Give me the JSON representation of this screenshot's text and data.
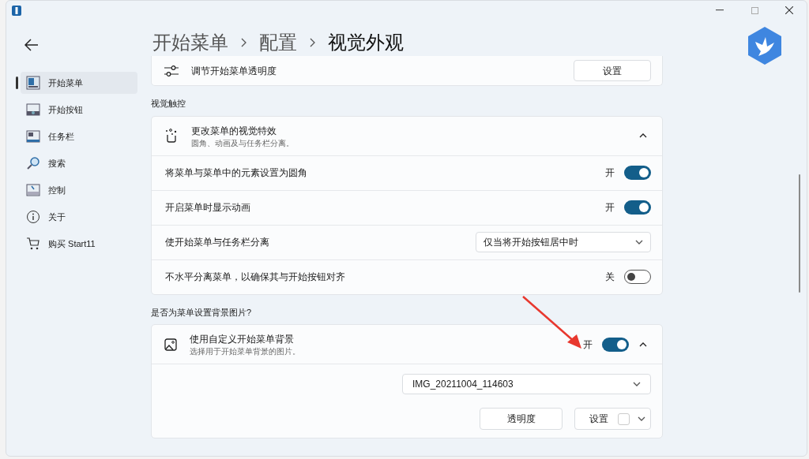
{
  "breadcrumb": [
    "开始菜单",
    "配置",
    "视觉外观"
  ],
  "sidebar": {
    "items": [
      {
        "label": "开始菜单",
        "selected": true
      },
      {
        "label": "开始按钮",
        "selected": false
      },
      {
        "label": "任务栏",
        "selected": false
      },
      {
        "label": "搜索",
        "selected": false
      },
      {
        "label": "控制",
        "selected": false
      },
      {
        "label": "关于",
        "selected": false
      },
      {
        "label": "购买 Start11",
        "selected": false
      }
    ]
  },
  "top_card": {
    "label": "调节开始菜单透明度",
    "button": "设置"
  },
  "sections": [
    {
      "title": "视觉触控",
      "card": {
        "title": "更改菜单的视觉特效",
        "subtitle": "圆角、动画及与任务栏分离。",
        "expanded": true,
        "rows": [
          {
            "kind": "toggle",
            "label": "将菜单与菜单中的元素设置为圆角",
            "state_label": "开",
            "on": true
          },
          {
            "kind": "toggle",
            "label": "开启菜单时显示动画",
            "state_label": "开",
            "on": true
          },
          {
            "kind": "dropdown",
            "label": "使开始菜单与任务栏分离",
            "value": "仅当将开始按钮居中时"
          },
          {
            "kind": "toggle",
            "label": "不水平分离菜单，以确保其与开始按钮对齐",
            "state_label": "关",
            "on": false
          }
        ]
      }
    },
    {
      "title": "是否为菜单设置背景图片?",
      "card": {
        "title": "使用自定义开始菜单背景",
        "subtitle": "选择用于开始菜单背景的图片。",
        "state_label": "开",
        "on": true,
        "expanded": true,
        "rows": [
          {
            "kind": "wide_dropdown",
            "value": "IMG_20211004_114603"
          },
          {
            "kind": "buttons",
            "button": "透明度",
            "color_button": "设置"
          }
        ]
      }
    }
  ]
}
